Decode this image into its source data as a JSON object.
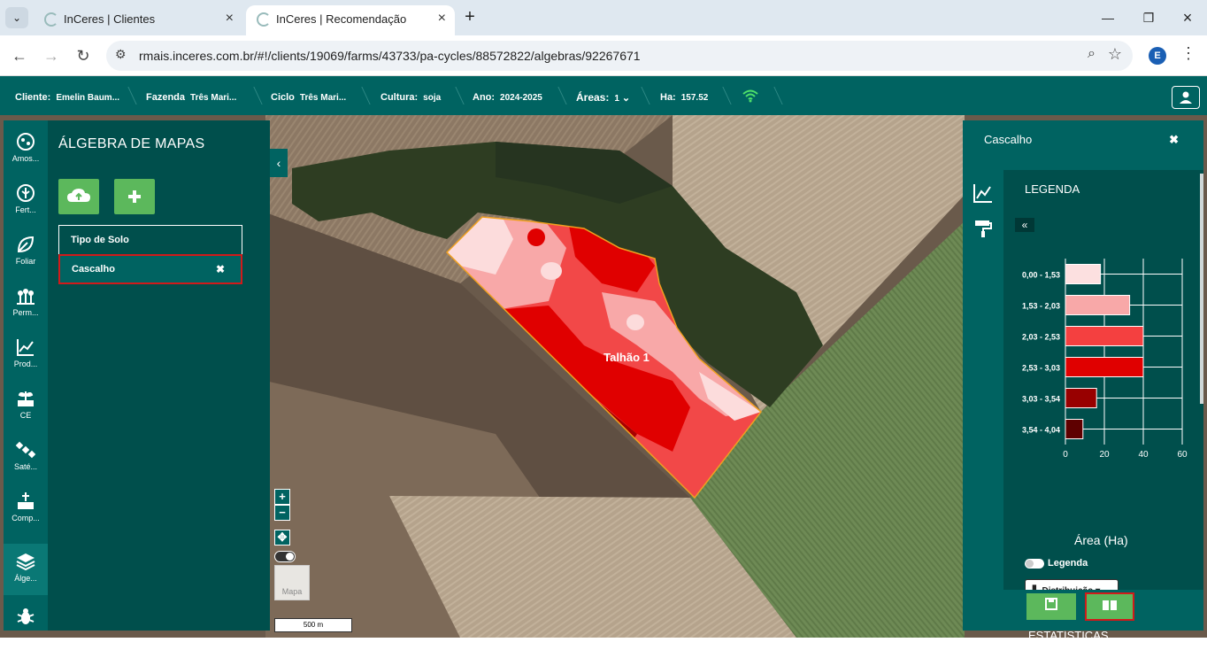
{
  "browser": {
    "tabs": [
      {
        "title": "InCeres | Clientes"
      },
      {
        "title": "InCeres | Recomendação"
      }
    ],
    "url": "rmais.inceres.com.br/#!/clients/19069/farms/43733/pa-cycles/88572822/algebras/92267671",
    "profile_initial": "E"
  },
  "appnav": {
    "cliente_label": "Cliente:",
    "cliente_value": "Emelin Baum...",
    "fazenda_label": "Fazenda",
    "fazenda_value": "Três Mari...",
    "ciclo_label": "Ciclo",
    "ciclo_value": "Três Mari...",
    "cultura_label": "Cultura:",
    "cultura_value": "soja",
    "ano_label": "Ano:",
    "ano_value": "2024-2025",
    "areas_label": "Áreas:",
    "areas_value": "1",
    "ha_label": "Ha:",
    "ha_value": "157.52"
  },
  "sidenav": [
    {
      "label": "Amos..."
    },
    {
      "label": "Fert..."
    },
    {
      "label": "Foliar"
    },
    {
      "label": "Perm..."
    },
    {
      "label": "Prod..."
    },
    {
      "label": "CE"
    },
    {
      "label": "Saté..."
    },
    {
      "label": "Comp..."
    },
    {
      "label": "Álge..."
    }
  ],
  "panel": {
    "title": "ÁLGEBRA DE MAPAS",
    "layers": [
      {
        "label": "Tipo de Solo"
      },
      {
        "label": "Cascalho"
      }
    ]
  },
  "map": {
    "field_label": "Talhão 1",
    "basemap_label": "Mapa",
    "scale_label": "500 m"
  },
  "right_panel": {
    "title": "Cascalho",
    "legend_title": "LEGENDA",
    "legend_toggle_label": "Legenda",
    "distribution_button": "Distribuição",
    "stats_title": "ESTATÍSTICAS"
  },
  "chart_data": {
    "type": "bar",
    "orientation": "horizontal",
    "categories": [
      "0,00 - 1,53",
      "1,53 - 2,03",
      "2,03 - 2,53",
      "2,53 - 3,03",
      "3,03 - 3,54",
      "3,54 - 4,04"
    ],
    "values": [
      18,
      33,
      40,
      40,
      16,
      9
    ],
    "colors": [
      "#fce0e0",
      "#f8a8a8",
      "#f44040",
      "#e00000",
      "#980000",
      "#5e0000"
    ],
    "xlabel": "Área (Ha)",
    "xlim": [
      0,
      60
    ],
    "xticks": [
      "0",
      "20",
      "40",
      "60"
    ],
    "grid": true
  }
}
